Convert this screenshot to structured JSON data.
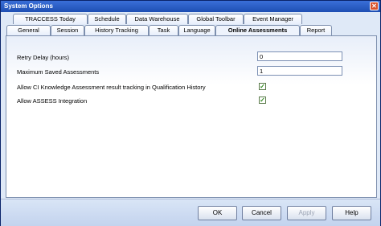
{
  "window": {
    "title": "System Options"
  },
  "tabs_back": [
    "TRACCESS Today",
    "Schedule",
    "Data Warehouse",
    "Global Toolbar",
    "Event Manager"
  ],
  "tabs_front": [
    "General",
    "Session",
    "History Tracking",
    "Task",
    "Language",
    "Online Assessments",
    "Report"
  ],
  "active_tab": "Online Assessments",
  "settings": {
    "retry_delay_label": "Retry Delay (hours)",
    "retry_delay_value": "0",
    "max_saved_label": "Maximum Saved Assessments",
    "max_saved_value": "1",
    "allow_ci_label": "Allow CI Knowledge Assessment result tracking in Qualification History",
    "allow_ci_checked": true,
    "allow_assess_label": "Allow ASSESS Integration",
    "allow_assess_checked": true
  },
  "buttons": {
    "ok": "OK",
    "cancel": "Cancel",
    "apply": "Apply",
    "help": "Help"
  },
  "icons": {
    "close": "close-icon",
    "check": "checkmark-icon"
  }
}
